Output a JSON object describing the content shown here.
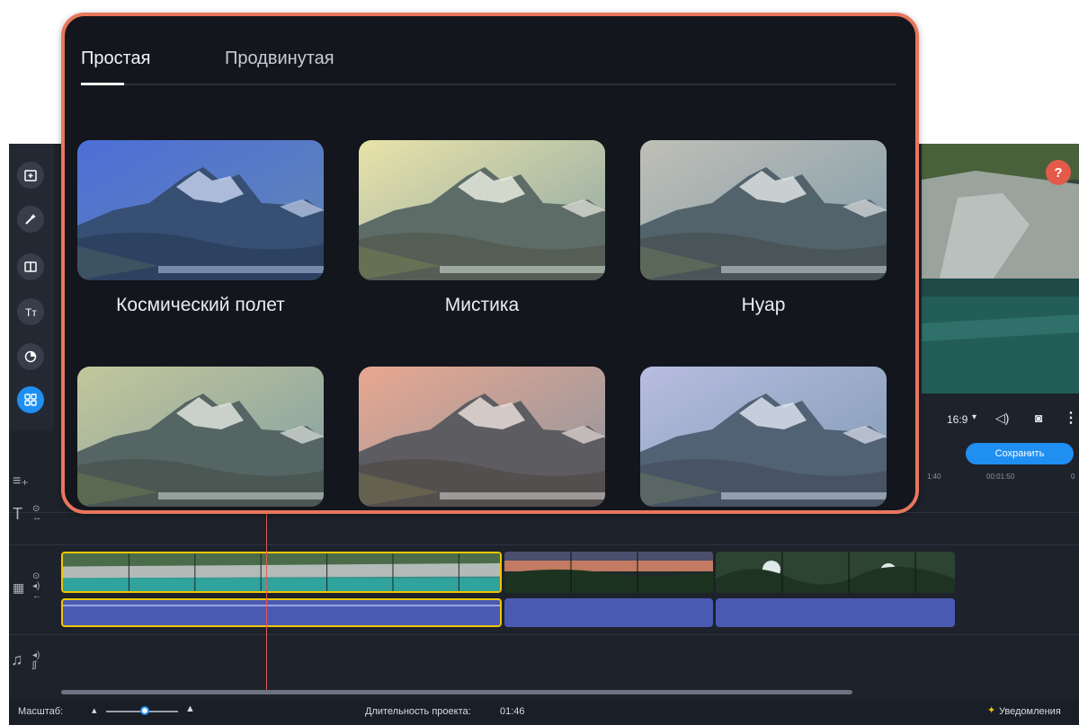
{
  "tabs": {
    "simple": "Простая",
    "advanced": "Продвинутая"
  },
  "filters": [
    {
      "label": "Космический полет",
      "tint": "#4d6fd8"
    },
    {
      "label": "Мистика",
      "tint": "#e9e3a8"
    },
    {
      "label": "Нуар",
      "tint": "#bfbfb6"
    },
    {
      "label": "",
      "tint": "#c2c79a"
    },
    {
      "label": "",
      "tint": "#e9a790"
    },
    {
      "label": "",
      "tint": "#b8bde0"
    }
  ],
  "player": {
    "aspect": "16:9",
    "save_label": "Сохранить",
    "help": "?"
  },
  "ruler": {
    "t1": "1:40",
    "t2": "00:01:50",
    "t3": "0"
  },
  "status": {
    "zoom_label": "Масштаб:",
    "duration_label": "Длительность проекта:",
    "duration_value": "01:46",
    "notifications": "Уведомления"
  },
  "colors": {
    "accent": "#1f8ff2",
    "panel_border": "#e8765c",
    "clip_audio": "#4a5ab3",
    "selection": "#f2c500"
  }
}
